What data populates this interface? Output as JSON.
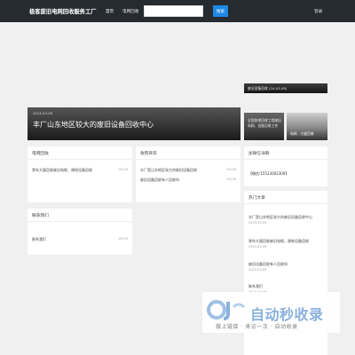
{
  "header": {
    "logo": "极客废旧电网回收服务工厂",
    "nav": [
      "首页",
      "电网回收"
    ],
    "search_placeholder": "",
    "search_button": "搜索",
    "login": "登录"
  },
  "hero": {
    "date": "2024-03-09",
    "title": "丰厂山东地区较大的废旧设备回收中心"
  },
  "side_heroes": [
    "废旧设备回收 (24-03-09)",
    "全国各地回收工程废旧电网、设备回收工作",
    "电网 - 大量回收"
  ],
  "cards": {
    "recycle": {
      "title": "电网回收",
      "rows": [
        {
          "text": "常年大量回收废旧电缆，建筑设备回收",
          "date": "03-09"
        }
      ]
    },
    "news": {
      "title": "收购资讯",
      "rows": [
        {
          "text": "丰厂是山东地区较大的废旧设备回收",
          "date": "03-09"
        },
        {
          "text": "废旧设备回收有人回收吗",
          "date": "03-09"
        }
      ]
    },
    "contact": {
      "title": "联系我们",
      "rows": [
        {
          "text": "联系我们",
          "date": "03-09"
        }
      ]
    },
    "join": {
      "title": "加微信详聊",
      "text": "【微信:15523002300】"
    },
    "hot": {
      "title": "热门文章",
      "items": [
        {
          "text": "丰厂是山东地区较大的废旧设备回收中心",
          "date": "2023-03-09"
        },
        {
          "text": "常年大量回收废旧电缆，建筑设备回收",
          "date": "2023-03-09"
        },
        {
          "text": "废旧设备回收有人回收吗",
          "date": "2023-03-09"
        },
        {
          "text": "联系我们",
          "date": "2023-03-09"
        }
      ]
    }
  },
  "watermark": {
    "logo_text": "自动秒收录",
    "sub": "做上链接 · 来访一次 · 自动收录"
  }
}
